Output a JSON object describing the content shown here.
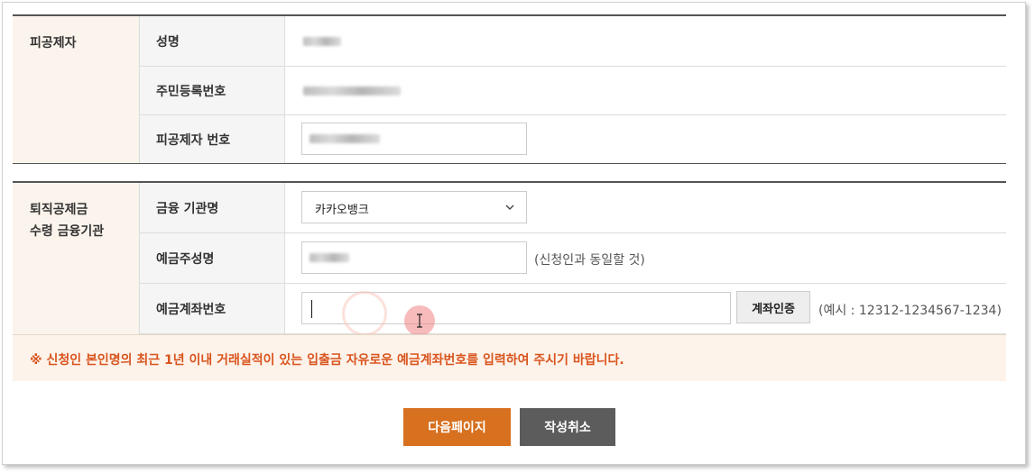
{
  "deductee": {
    "category": "피공제자",
    "name_label": "성명",
    "rrn_label": "주민등록번호",
    "number_label": "피공제자 번호"
  },
  "bank": {
    "category_line1": "퇴직공제금",
    "category_line2": "수령 금융기관",
    "bank_label": "금융 기관명",
    "bank_selected": "카카오뱅크",
    "holder_label": "예금주성명",
    "holder_hint": "(신청인과 동일할 것)",
    "account_label": "예금계좌번호",
    "account_value": "",
    "verify_label": "계좌인증",
    "account_example": "(예시 : 12312-1234567-1234)"
  },
  "notice": "※ 신청인 본인명의 최근 1년 이내 거래실적이 있는 입출금 자유로운 예금계좌번호를 입력하여 주시기 바랍니다.",
  "actions": {
    "next_label": "다음페이지",
    "cancel_label": "작성취소"
  },
  "colors": {
    "accent": "#d7701f",
    "notice_text": "#d9541e",
    "cancel_bg": "#5c5c5c",
    "category_bg": "#fbf4ec"
  },
  "icons": {
    "select": "chevron-down-icon",
    "cursor": "text-cursor-icon"
  }
}
